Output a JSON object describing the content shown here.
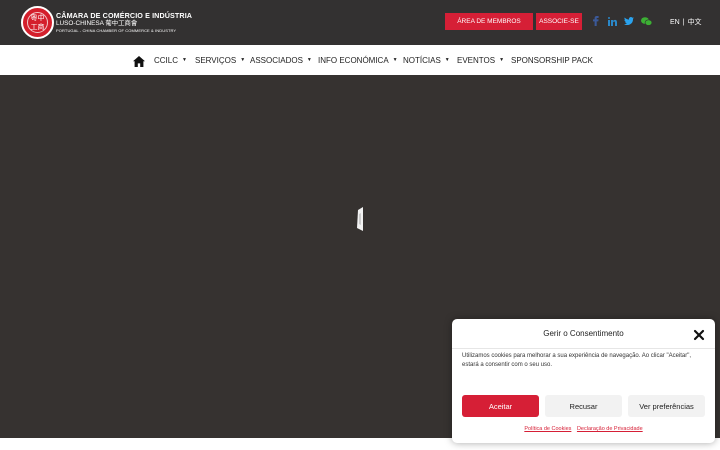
{
  "header": {
    "logo": {
      "seal_text": "粵中工商",
      "line1": "CÂMARA DE COMÉRCIO E INDÚSTRIA",
      "line2": "LUSO-CHINESA   葡中工商會",
      "line3": "PORTUGAL - CHINA CHAMBER OF COMMERCE & INDUSTRY"
    },
    "members_button": "ÁREA DE MEMBROS",
    "join_button": "ASSOCIE-SE",
    "social": [
      {
        "icon": "facebook-icon",
        "color": "#3b5998"
      },
      {
        "icon": "linkedin-icon",
        "color": "#2a88c9"
      },
      {
        "icon": "twitter-icon",
        "color": "#2aa3ef"
      },
      {
        "icon": "wechat-icon",
        "color": "#3cb034"
      }
    ],
    "lang": {
      "current": "EN",
      "separator": "|",
      "other": "中文"
    }
  },
  "nav": {
    "home_icon": "home-icon",
    "items": [
      {
        "label": "CCILC",
        "has_dropdown": true
      },
      {
        "label": "SERVIÇOS",
        "has_dropdown": true
      },
      {
        "label": "ASSOCIADOS",
        "has_dropdown": true
      },
      {
        "label": "INFO ECONÓMICA",
        "has_dropdown": true
      },
      {
        "label": "NOTÍCIAS",
        "has_dropdown": true
      },
      {
        "label": "EVENTOS",
        "has_dropdown": true
      },
      {
        "label": "SPONSORSHIP PACK",
        "has_dropdown": false
      }
    ],
    "caret": "▼"
  },
  "hero": {
    "background": "#363230"
  },
  "consent": {
    "title": "Gerir o Consentimento",
    "close_icon": "close-icon",
    "text": "Utilizamos cookies para melhorar a sua experiência de navegação. Ao clicar \"Aceitar\", estará a consentir com o seu uso.",
    "accept": "Aceitar",
    "deny": "Recusar",
    "preferences": "Ver preferências",
    "link_cookies": "Política de Cookies",
    "link_privacy": "Declaração de Privacidade"
  },
  "colors": {
    "topbar": "#333131",
    "accent": "#d61f36",
    "hero": "#363230"
  }
}
